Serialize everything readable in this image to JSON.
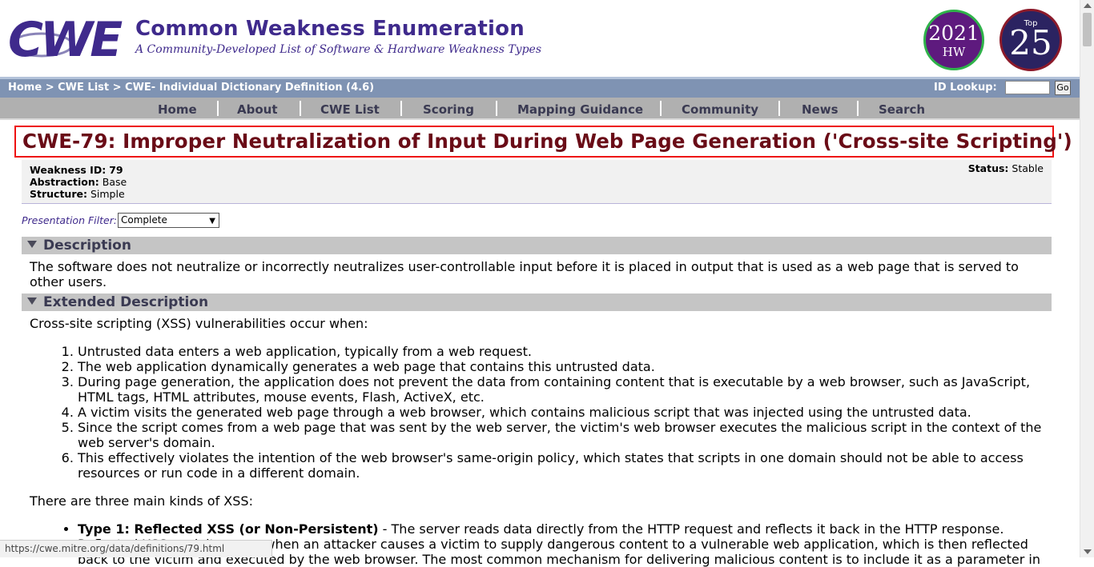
{
  "header": {
    "logo_text": "CWE",
    "title": "Common Weakness Enumeration",
    "subtitle": "A Community-Developed List of Software & Hardware Weakness Types",
    "badge_hw_year": "2021",
    "badge_hw_label": "HW",
    "badge_top_label": "Top",
    "badge_top_number": "25"
  },
  "breadcrumb": {
    "text": "Home > CWE List > CWE- Individual Dictionary Definition (4.6)",
    "id_lookup_label": "ID Lookup:",
    "id_lookup_value": "",
    "go_label": "Go"
  },
  "nav": {
    "items": [
      "Home",
      "About",
      "CWE List",
      "Scoring",
      "Mapping Guidance",
      "Community",
      "News",
      "Search"
    ]
  },
  "page": {
    "title": "CWE-79: Improper Neutralization of Input During Web Page Generation ('Cross-site Scripting')",
    "weakness_id_label": "Weakness ID:",
    "weakness_id": "79",
    "abstraction_label": "Abstraction:",
    "abstraction": "Base",
    "structure_label": "Structure:",
    "structure": "Simple",
    "status_label": "Status:",
    "status": "Stable",
    "filter_label": "Presentation Filter:",
    "filter_value": "Complete"
  },
  "description": {
    "header": "Description",
    "text": "The software does not neutralize or incorrectly neutralizes user-controllable input before it is placed in output that is used as a web page that is served to other users."
  },
  "extended": {
    "header": "Extended Description",
    "intro": "Cross-site scripting (XSS) vulnerabilities occur when:",
    "items": [
      "Untrusted data enters a web application, typically from a web request.",
      "The web application dynamically generates a web page that contains this untrusted data.",
      "During page generation, the application does not prevent the data from containing content that is executable by a web browser, such as JavaScript, HTML tags, HTML attributes, mouse events, Flash, ActiveX, etc.",
      "A victim visits the generated web page through a web browser, which contains malicious script that was injected using the untrusted data.",
      "Since the script comes from a web page that was sent by the web server, the victim's web browser executes the malicious script in the context of the web server's domain.",
      "This effectively violates the intention of the web browser's same-origin policy, which states that scripts in one domain should not be able to access resources or run code in a different domain."
    ],
    "kinds_intro": "There are three main kinds of XSS:",
    "type1_title": "Type 1: Reflected XSS (or Non-Persistent)",
    "type1_text": " - The server reads data directly from the HTTP request and reflects it back in the HTTP response. Reflected XSS exploits occur when an attacker causes a victim to supply dangerous content to a vulnerable web application, which is then reflected back to the victim and executed by the web browser. The most common mechanism for delivering malicious content is to include it as a parameter in"
  },
  "statusbar": {
    "url": "https://cwe.mitre.org/data/definitions/79.html"
  }
}
